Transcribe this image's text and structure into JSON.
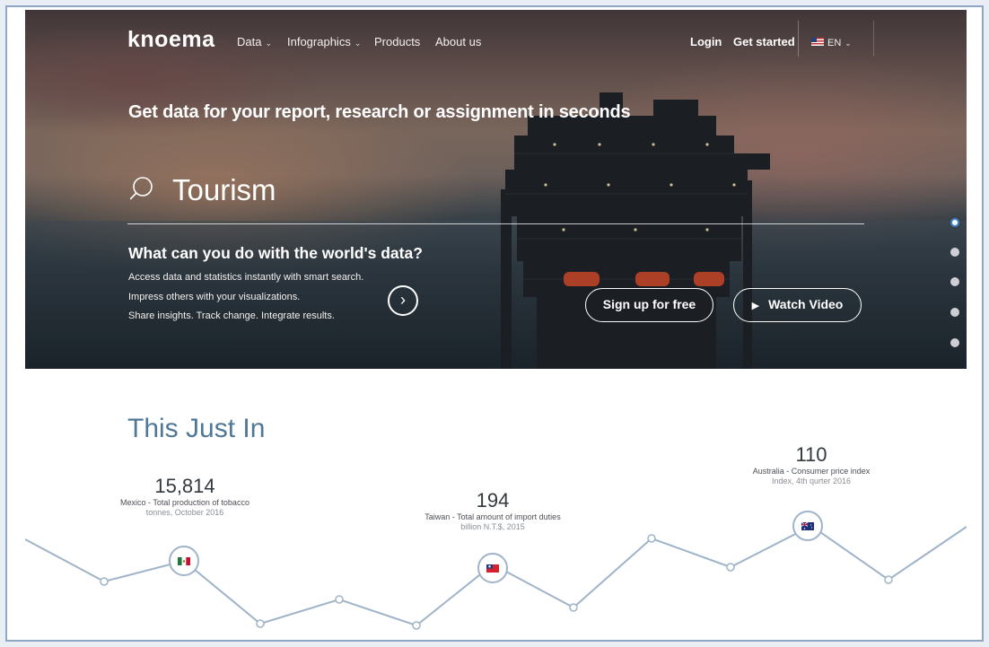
{
  "nav": {
    "logo": "knoema",
    "items": [
      {
        "label": "Data",
        "dropdown": true
      },
      {
        "label": "Infographics",
        "dropdown": true
      },
      {
        "label": "Products",
        "dropdown": false
      },
      {
        "label": "About us",
        "dropdown": false
      }
    ],
    "login": "Login",
    "get_started": "Get started",
    "language": "EN"
  },
  "hero": {
    "headline": "Get data for your report, research or assignment in seconds",
    "search_value": "Tourism",
    "subheadline": "What can you do with the world's data?",
    "lines": [
      "Access data and statistics instantly with smart search.",
      "Impress others with your visualizations.",
      "Share insights. Track change. Integrate results."
    ],
    "signup_label": "Sign up for free",
    "watch_label": "Watch Video",
    "slide_count": 5,
    "active_slide": 0
  },
  "just_in": {
    "title": "This Just In",
    "stats": [
      {
        "value": "15,814",
        "label": "Mexico - Total production of tobacco",
        "sub": "tonnes, October 2016",
        "flag": "mexico-flag-icon"
      },
      {
        "value": "194",
        "label": "Taiwan - Total amount of import duties",
        "sub": "billion N.T.$, 2015",
        "flag": "taiwan-flag-icon"
      },
      {
        "value": "110",
        "label": "Australia - Consumer price index",
        "sub": "Index, 4th qurter 2016",
        "flag": "australia-flag-icon"
      }
    ]
  },
  "colors": {
    "accent": "#4f7898",
    "line": "#9fb4c8",
    "active_dot": "#3f86c7"
  }
}
